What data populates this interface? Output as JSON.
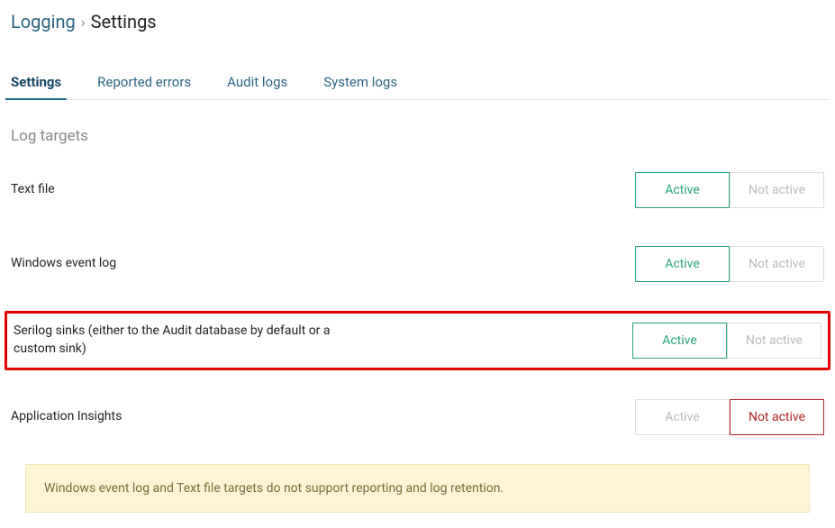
{
  "breadcrumb": {
    "parent": "Logging",
    "separator": "›",
    "current": "Settings"
  },
  "tabs": [
    {
      "label": "Settings",
      "active": true
    },
    {
      "label": "Reported errors",
      "active": false
    },
    {
      "label": "Audit logs",
      "active": false
    },
    {
      "label": "System logs",
      "active": false
    }
  ],
  "section_title": "Log targets",
  "toggle_labels": {
    "active": "Active",
    "not_active": "Not active"
  },
  "targets": [
    {
      "label": "Text file",
      "state": "active",
      "highlighted": false
    },
    {
      "label": "Windows event log",
      "state": "active",
      "highlighted": false
    },
    {
      "label": "Serilog sinks (either to the Audit database by default or a custom sink)",
      "state": "active",
      "highlighted": true
    },
    {
      "label": "Application Insights",
      "state": "not_active",
      "highlighted": false
    }
  ],
  "alert_text": "Windows event log and Text file targets do not support reporting and log retention."
}
